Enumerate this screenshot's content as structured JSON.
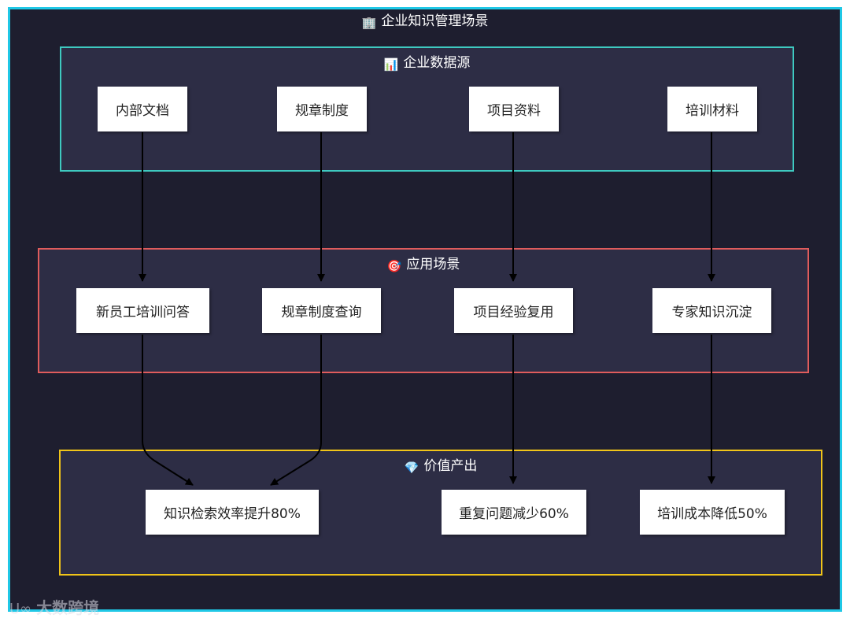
{
  "title": {
    "icon": "office-building-icon",
    "text": "企业知识管理场景"
  },
  "groups": {
    "sources": {
      "icon": "bar-chart-icon",
      "title": "企业数据源",
      "border_color": "#3ec9c0"
    },
    "scenarios": {
      "icon": "target-icon",
      "title": "应用场景",
      "border_color": "#e05c5c"
    },
    "value": {
      "icon": "gem-icon",
      "title": "价值产出",
      "border_color": "#f0c419"
    }
  },
  "nodes": {
    "internal_docs": "内部文档",
    "regulations": "规章制度",
    "project_materials": "项目资料",
    "training_materials": "培训材料",
    "new_employee_qa": "新员工培训问答",
    "regulation_query": "规章制度查询",
    "project_experience": "项目经验复用",
    "expert_knowledge": "专家知识沉淀",
    "search_efficiency": "知识检索效率提升80%",
    "fewer_repeat_questions": "重复问题减少60%",
    "training_cost": "培训成本降低50%"
  },
  "edges": [
    [
      "internal_docs",
      "new_employee_qa"
    ],
    [
      "regulations",
      "regulation_query"
    ],
    [
      "project_materials",
      "project_experience"
    ],
    [
      "training_materials",
      "expert_knowledge"
    ],
    [
      "new_employee_qa",
      "search_efficiency"
    ],
    [
      "regulation_query",
      "search_efficiency"
    ],
    [
      "project_experience",
      "fewer_repeat_questions"
    ],
    [
      "expert_knowledge",
      "training_cost"
    ]
  ],
  "watermark": {
    "logo": "logo-icon",
    "text": "大数跨境"
  },
  "colors": {
    "background": "#1e1e2f",
    "frame": "#1fc8e6",
    "group_fill": "#2d2d45"
  }
}
